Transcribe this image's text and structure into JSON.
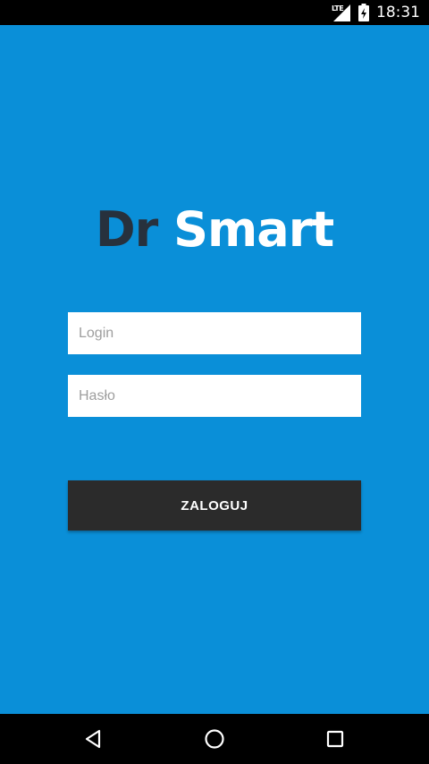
{
  "status_bar": {
    "network_label": "LTE",
    "time": "18:31",
    "icons": [
      "signal-icon",
      "battery-charging-icon"
    ]
  },
  "logo": {
    "part1": "Dr",
    "part2": "Smart"
  },
  "form": {
    "login_placeholder": "Login",
    "password_placeholder": "Hasło",
    "submit_label": "ZALOGUJ"
  },
  "nav_bar": {
    "icons": [
      "back-icon",
      "home-icon",
      "recents-icon"
    ]
  },
  "colors": {
    "background": "#0a8fd8",
    "logo_dark": "#27313d",
    "button": "#2b2b2b"
  }
}
